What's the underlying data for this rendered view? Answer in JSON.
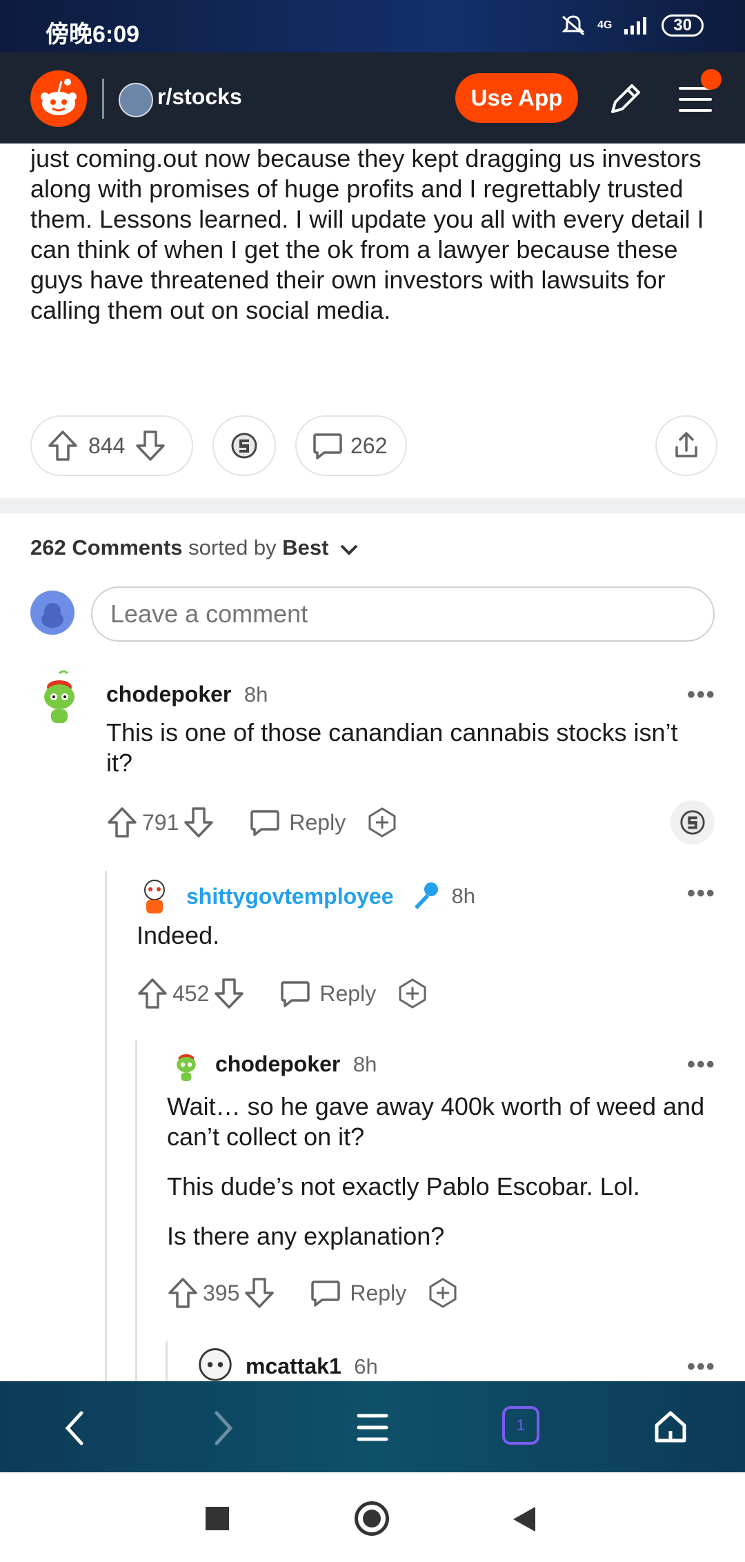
{
  "status_bar": {
    "time": "傍晚6:09",
    "network": "4G",
    "battery": "30"
  },
  "header": {
    "subreddit": "r/stocks",
    "use_app_label": "Use App"
  },
  "post": {
    "body": "just coming.out now because they kept dragging us investors along with promises of huge profits and I regrettably trusted them. Lessons learned. I will update you all with every detail I can think of when I get the ok from a lawyer because these guys have threatened their own investors with lawsuits for calling them out on social media.",
    "score": "844",
    "comments": "262"
  },
  "comments_header": {
    "count_label": "262 Comments",
    "sorted_by": "sorted by",
    "sort": "Best"
  },
  "comment_input": {
    "placeholder": "Leave a comment"
  },
  "comments": [
    {
      "author": "chodepoker",
      "age": "8h",
      "text": "This is one of those canandian cannabis stocks isn’t it?",
      "score": "791",
      "reply_label": "Reply"
    },
    {
      "author": "shittygovtemployee",
      "age": "8h",
      "text": "Indeed.",
      "score": "452",
      "reply_label": "Reply"
    },
    {
      "author": "chodepoker",
      "age": "8h",
      "paragraphs": [
        "Wait… so he gave away 400k worth of weed and can’t collect on it?",
        "This dude’s not exactly Pablo Escobar. Lol.",
        "Is there any explanation?"
      ],
      "score": "395",
      "reply_label": "Reply"
    },
    {
      "author": "mcattak1",
      "age": "6h"
    }
  ],
  "browser_bar": {
    "tab_count": "1"
  },
  "colors": {
    "brand": "#ff4500",
    "mod": "#24a0ed",
    "header_bg": "#1c2431"
  }
}
